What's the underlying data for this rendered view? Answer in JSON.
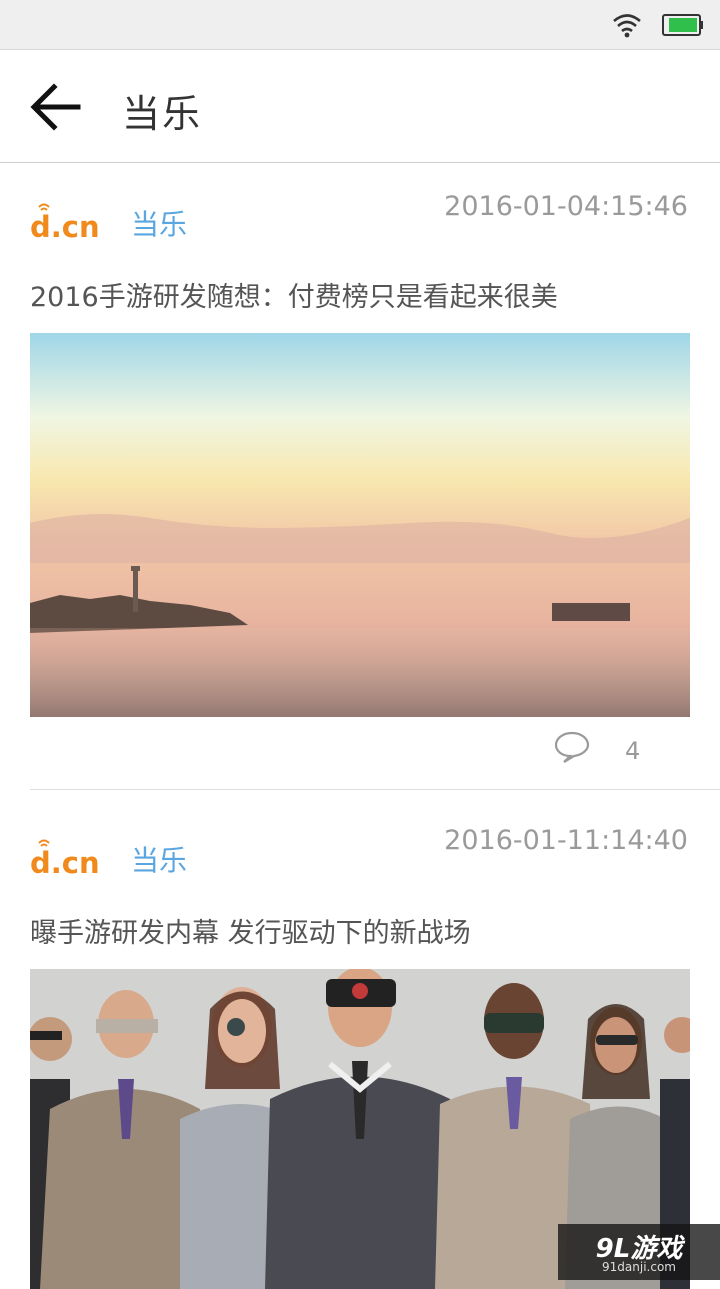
{
  "header": {
    "title": "当乐"
  },
  "articles": [
    {
      "source": "当乐",
      "logo_text": "d.cn",
      "time": "2016-01-04:15:46",
      "title": "2016手游研发随想：付费榜只是看起来很美",
      "comments": "4"
    },
    {
      "source": "当乐",
      "logo_text": "d.cn",
      "time": "2016-01-11:14:40",
      "title": "曝手游研发内幕 发行驱动下的新战场"
    }
  ],
  "watermark": {
    "main": "9L游戏",
    "sub": "91danji.com"
  },
  "colors": {
    "accent": "#5aa6e0",
    "logo_orange": "#f08a1c",
    "battery_green": "#2fbf4a"
  }
}
